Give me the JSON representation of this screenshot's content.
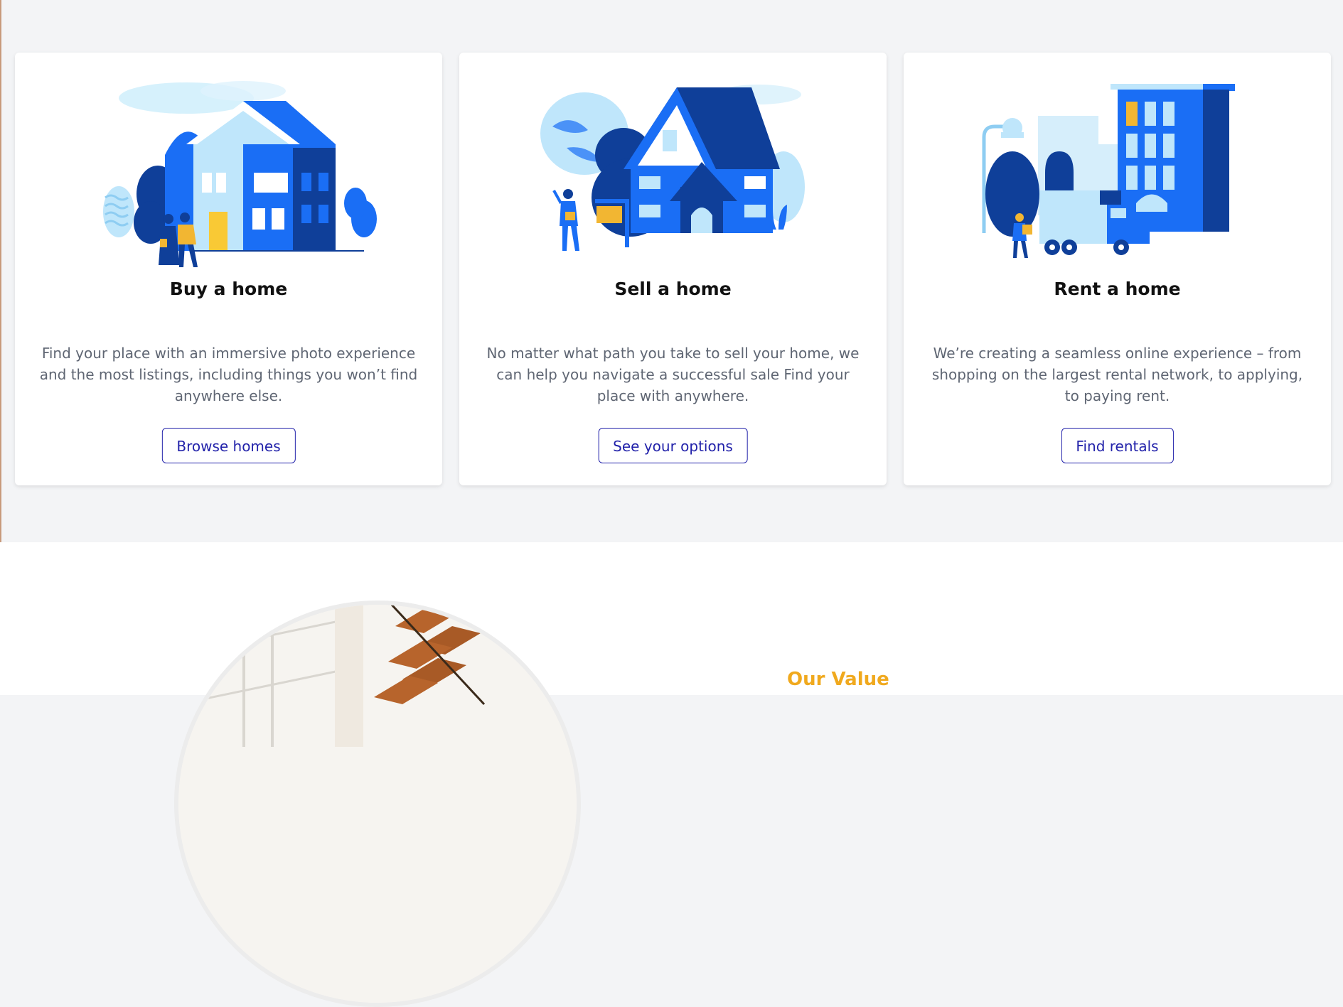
{
  "cards": [
    {
      "title": "Buy a home",
      "description": "Find your place with an immersive photo experience and the most listings, including things you won’t find anywhere else.",
      "button_label": "Browse homes",
      "illustration": "buy-home-illustration"
    },
    {
      "title": "Sell a home",
      "description": "No matter what path you take to sell your home, we can help you navigate a successful sale Find your place with anywhere.",
      "button_label": "See your options",
      "illustration": "sell-home-illustration"
    },
    {
      "title": "Rent a home",
      "description": "We’re creating a seamless online experience – from shopping on the largest rental network, to applying, to paying rent.",
      "button_label": "Find rentals",
      "illustration": "rent-home-illustration"
    }
  ],
  "value_section": {
    "label": "Our Value",
    "image": "staircase-interior-photo"
  },
  "colors": {
    "accent_blue": "#1a6ef5",
    "dark_blue": "#0f3f99",
    "light_blue": "#bfe6fb",
    "yellow": "#f2b632",
    "button_text": "#2222aa",
    "value_label": "#f0a91e"
  }
}
